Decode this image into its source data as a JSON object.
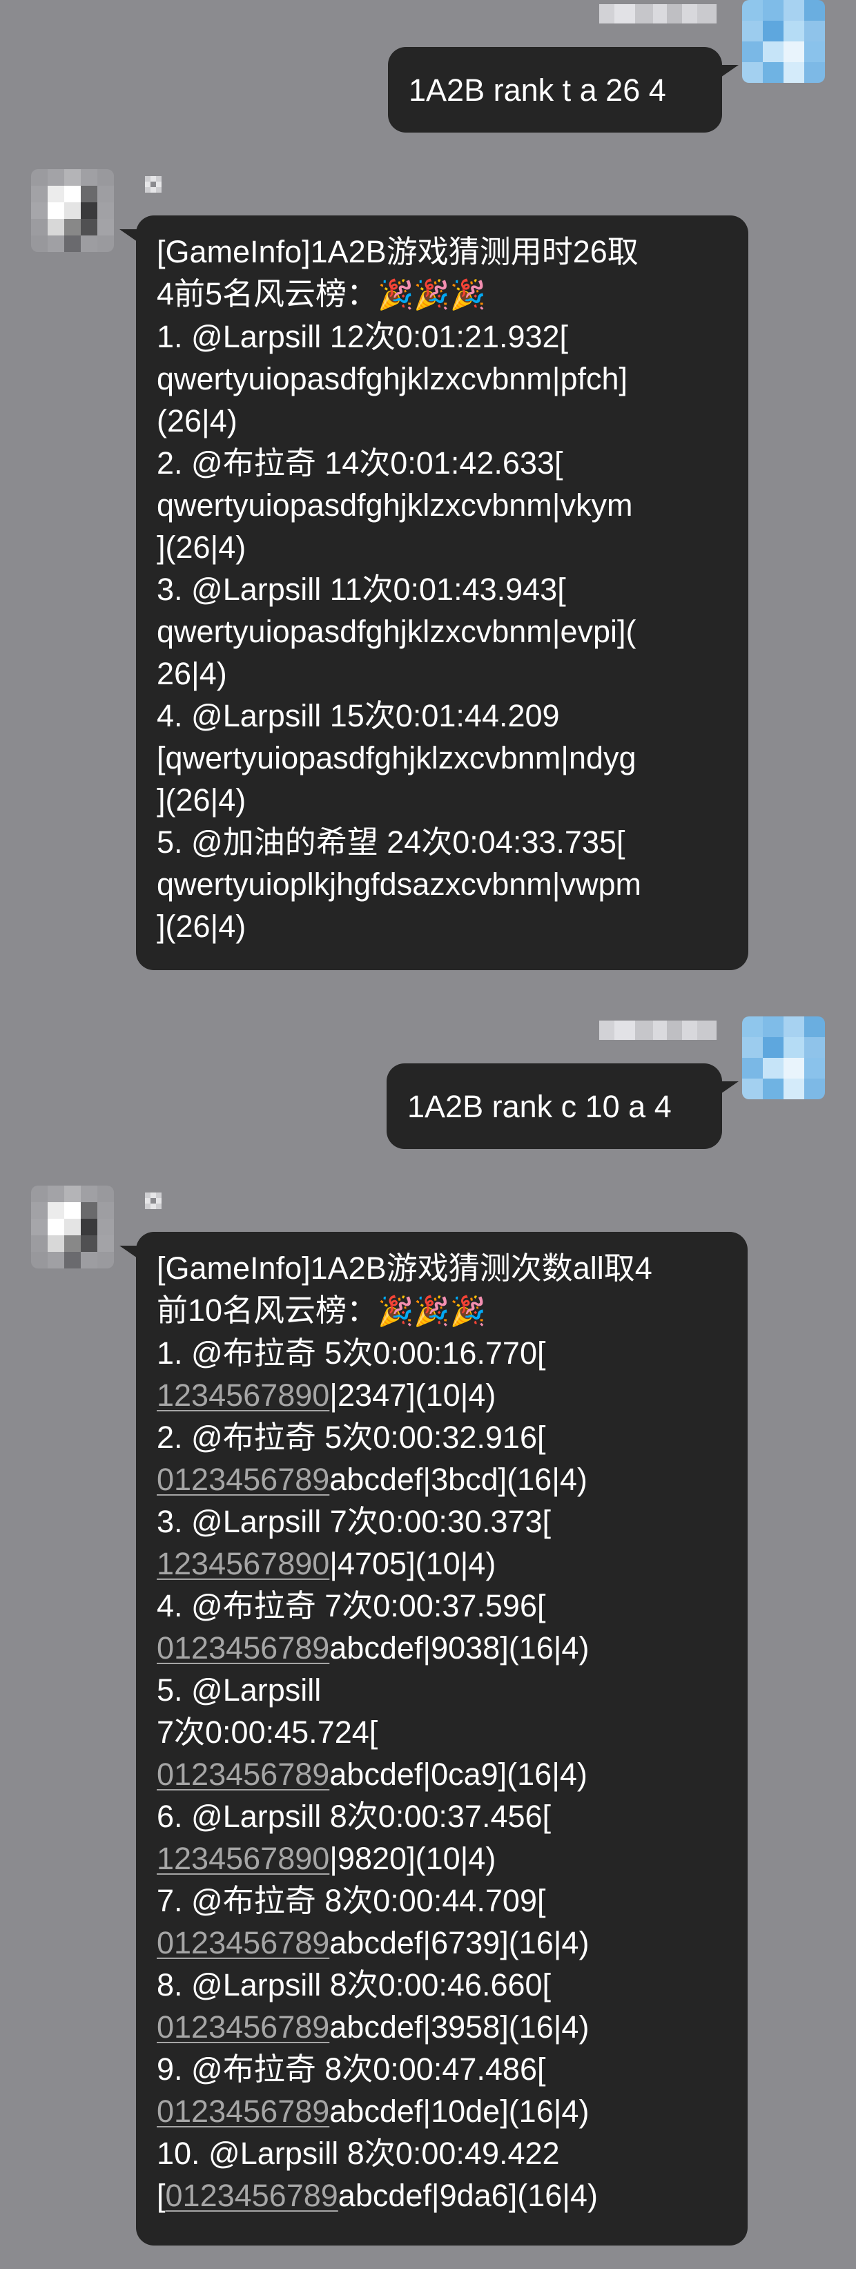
{
  "messages": [
    {
      "direction": "outgoing",
      "text": "1A2B rank t a 26 4"
    },
    {
      "direction": "incoming",
      "lines": [
        [
          "[GameInfo]1A2B游戏猜测用时26取"
        ],
        [
          "4前5名风云榜：",
          "🎉🎉🎉"
        ],
        [
          "1. @Larpsill 12次0:01:21.932["
        ],
        [
          "qwertyuiopasdfghjklzxcvbnm|pfch]"
        ],
        [
          "(26|4)"
        ],
        [
          "2. @布拉奇 14次0:01:42.633["
        ],
        [
          "qwertyuiopasdfghjklzxcvbnm|vkym"
        ],
        [
          "](26|4)"
        ],
        [
          "3. @Larpsill 11次0:01:43.943["
        ],
        [
          "qwertyuiopasdfghjklzxcvbnm|evpi]("
        ],
        [
          "26|4)"
        ],
        [
          "4. @Larpsill 15次0:01:44.209"
        ],
        [
          "[qwertyuiopasdfghjklzxcvbnm|ndyg"
        ],
        [
          "](26|4)"
        ],
        [
          "5. @加油的希望 24次0:04:33.735["
        ],
        [
          "qwertyuioplkjhgfdsazxcvbnm|vwpm"
        ],
        [
          "](26|4)"
        ]
      ]
    },
    {
      "direction": "outgoing",
      "text": "1A2B rank c 10 a 4"
    },
    {
      "direction": "incoming",
      "lines": [
        [
          "[GameInfo]1A2B游戏猜测次数all取4"
        ],
        [
          "前10名风云榜：",
          "🎉🎉🎉"
        ],
        [
          "1. @布拉奇 5次0:00:16.770["
        ],
        [
          "",
          "1234567890",
          "|2347](10|4)"
        ],
        [
          "2. @布拉奇 5次0:00:32.916["
        ],
        [
          "",
          "0123456789",
          "abcdef|3bcd](16|4)"
        ],
        [
          "3. @Larpsill 7次0:00:30.373["
        ],
        [
          "",
          "1234567890",
          "|4705](10|4)"
        ],
        [
          "4. @布拉奇 7次0:00:37.596["
        ],
        [
          "",
          "0123456789",
          "abcdef|9038](16|4)"
        ],
        [
          "5. @Larpsill"
        ],
        [
          " 7次0:00:45.724["
        ],
        [
          "",
          "0123456789",
          "abcdef|0ca9](16|4)"
        ],
        [
          "6. @Larpsill 8次0:00:37.456["
        ],
        [
          "",
          "1234567890",
          "|9820](10|4)"
        ],
        [
          "7. @布拉奇 8次0:00:44.709["
        ],
        [
          "",
          "0123456789",
          "abcdef|6739](16|4)"
        ],
        [
          "8. @Larpsill 8次0:00:46.660["
        ],
        [
          "",
          "0123456789",
          "abcdef|3958](16|4)"
        ],
        [
          "9. @布拉奇 8次0:00:47.486["
        ],
        [
          "",
          "0123456789",
          "abcdef|10de](16|4)"
        ],
        [
          "10. @Larpsill 8次0:00:49.422"
        ],
        [
          "[",
          "0123456789",
          "abcdef|9da6](16|4)"
        ]
      ]
    }
  ],
  "colors": {
    "background": "#8b8b8f",
    "bubble": "#252525",
    "text": "#ffffff",
    "link": "#a6a6a6"
  }
}
